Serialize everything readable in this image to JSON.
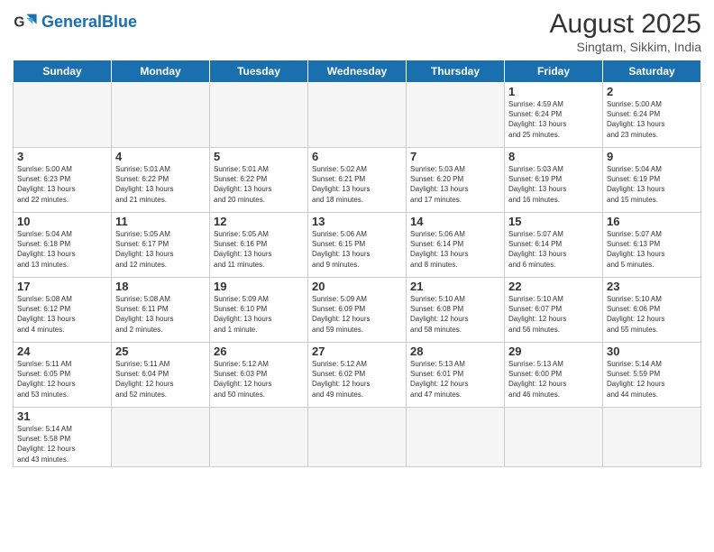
{
  "logo": {
    "general": "General",
    "blue": "Blue"
  },
  "title": "August 2025",
  "subtitle": "Singtam, Sikkim, India",
  "headers": [
    "Sunday",
    "Monday",
    "Tuesday",
    "Wednesday",
    "Thursday",
    "Friday",
    "Saturday"
  ],
  "weeks": [
    [
      {
        "day": "",
        "info": ""
      },
      {
        "day": "",
        "info": ""
      },
      {
        "day": "",
        "info": ""
      },
      {
        "day": "",
        "info": ""
      },
      {
        "day": "",
        "info": ""
      },
      {
        "day": "1",
        "info": "Sunrise: 4:59 AM\nSunset: 6:24 PM\nDaylight: 13 hours\nand 25 minutes."
      },
      {
        "day": "2",
        "info": "Sunrise: 5:00 AM\nSunset: 6:24 PM\nDaylight: 13 hours\nand 23 minutes."
      }
    ],
    [
      {
        "day": "3",
        "info": "Sunrise: 5:00 AM\nSunset: 6:23 PM\nDaylight: 13 hours\nand 22 minutes."
      },
      {
        "day": "4",
        "info": "Sunrise: 5:01 AM\nSunset: 6:22 PM\nDaylight: 13 hours\nand 21 minutes."
      },
      {
        "day": "5",
        "info": "Sunrise: 5:01 AM\nSunset: 6:22 PM\nDaylight: 13 hours\nand 20 minutes."
      },
      {
        "day": "6",
        "info": "Sunrise: 5:02 AM\nSunset: 6:21 PM\nDaylight: 13 hours\nand 18 minutes."
      },
      {
        "day": "7",
        "info": "Sunrise: 5:03 AM\nSunset: 6:20 PM\nDaylight: 13 hours\nand 17 minutes."
      },
      {
        "day": "8",
        "info": "Sunrise: 5:03 AM\nSunset: 6:19 PM\nDaylight: 13 hours\nand 16 minutes."
      },
      {
        "day": "9",
        "info": "Sunrise: 5:04 AM\nSunset: 6:19 PM\nDaylight: 13 hours\nand 15 minutes."
      }
    ],
    [
      {
        "day": "10",
        "info": "Sunrise: 5:04 AM\nSunset: 6:18 PM\nDaylight: 13 hours\nand 13 minutes."
      },
      {
        "day": "11",
        "info": "Sunrise: 5:05 AM\nSunset: 6:17 PM\nDaylight: 13 hours\nand 12 minutes."
      },
      {
        "day": "12",
        "info": "Sunrise: 5:05 AM\nSunset: 6:16 PM\nDaylight: 13 hours\nand 11 minutes."
      },
      {
        "day": "13",
        "info": "Sunrise: 5:06 AM\nSunset: 6:15 PM\nDaylight: 13 hours\nand 9 minutes."
      },
      {
        "day": "14",
        "info": "Sunrise: 5:06 AM\nSunset: 6:14 PM\nDaylight: 13 hours\nand 8 minutes."
      },
      {
        "day": "15",
        "info": "Sunrise: 5:07 AM\nSunset: 6:14 PM\nDaylight: 13 hours\nand 6 minutes."
      },
      {
        "day": "16",
        "info": "Sunrise: 5:07 AM\nSunset: 6:13 PM\nDaylight: 13 hours\nand 5 minutes."
      }
    ],
    [
      {
        "day": "17",
        "info": "Sunrise: 5:08 AM\nSunset: 6:12 PM\nDaylight: 13 hours\nand 4 minutes."
      },
      {
        "day": "18",
        "info": "Sunrise: 5:08 AM\nSunset: 6:11 PM\nDaylight: 13 hours\nand 2 minutes."
      },
      {
        "day": "19",
        "info": "Sunrise: 5:09 AM\nSunset: 6:10 PM\nDaylight: 13 hours\nand 1 minute."
      },
      {
        "day": "20",
        "info": "Sunrise: 5:09 AM\nSunset: 6:09 PM\nDaylight: 12 hours\nand 59 minutes."
      },
      {
        "day": "21",
        "info": "Sunrise: 5:10 AM\nSunset: 6:08 PM\nDaylight: 12 hours\nand 58 minutes."
      },
      {
        "day": "22",
        "info": "Sunrise: 5:10 AM\nSunset: 6:07 PM\nDaylight: 12 hours\nand 56 minutes."
      },
      {
        "day": "23",
        "info": "Sunrise: 5:10 AM\nSunset: 6:06 PM\nDaylight: 12 hours\nand 55 minutes."
      }
    ],
    [
      {
        "day": "24",
        "info": "Sunrise: 5:11 AM\nSunset: 6:05 PM\nDaylight: 12 hours\nand 53 minutes."
      },
      {
        "day": "25",
        "info": "Sunrise: 5:11 AM\nSunset: 6:04 PM\nDaylight: 12 hours\nand 52 minutes."
      },
      {
        "day": "26",
        "info": "Sunrise: 5:12 AM\nSunset: 6:03 PM\nDaylight: 12 hours\nand 50 minutes."
      },
      {
        "day": "27",
        "info": "Sunrise: 5:12 AM\nSunset: 6:02 PM\nDaylight: 12 hours\nand 49 minutes."
      },
      {
        "day": "28",
        "info": "Sunrise: 5:13 AM\nSunset: 6:01 PM\nDaylight: 12 hours\nand 47 minutes."
      },
      {
        "day": "29",
        "info": "Sunrise: 5:13 AM\nSunset: 6:00 PM\nDaylight: 12 hours\nand 46 minutes."
      },
      {
        "day": "30",
        "info": "Sunrise: 5:14 AM\nSunset: 5:59 PM\nDaylight: 12 hours\nand 44 minutes."
      }
    ],
    [
      {
        "day": "31",
        "info": "Sunrise: 5:14 AM\nSunset: 5:58 PM\nDaylight: 12 hours\nand 43 minutes."
      },
      {
        "day": "",
        "info": ""
      },
      {
        "day": "",
        "info": ""
      },
      {
        "day": "",
        "info": ""
      },
      {
        "day": "",
        "info": ""
      },
      {
        "day": "",
        "info": ""
      },
      {
        "day": "",
        "info": ""
      }
    ]
  ]
}
